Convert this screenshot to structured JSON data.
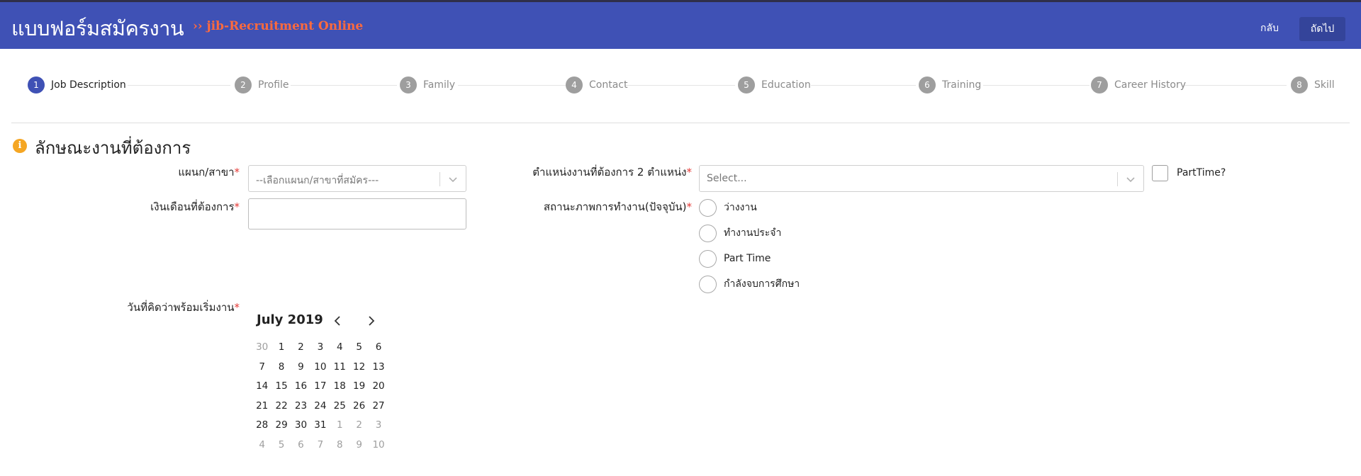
{
  "header": {
    "title": "แบบฟอร์มสมัครงาน",
    "subtitle": "›› jib-Recruitment Online",
    "back_label": "กลับ",
    "next_label": "ถัดไป",
    "bg_color": "#3f51b5",
    "accent_color": "#ff6a3d"
  },
  "steps": [
    {
      "num": "1",
      "label": "Job Description",
      "active": true
    },
    {
      "num": "2",
      "label": "Profile"
    },
    {
      "num": "3",
      "label": "Family"
    },
    {
      "num": "4",
      "label": "Contact"
    },
    {
      "num": "5",
      "label": "Education"
    },
    {
      "num": "6",
      "label": "Training"
    },
    {
      "num": "7",
      "label": "Career History"
    },
    {
      "num": "8",
      "label": "Skill"
    }
  ],
  "section": {
    "icon": "info-icon",
    "title": "ลักษณะงานที่ต้องการ"
  },
  "form": {
    "department_label": "แผนก/สาขา",
    "department_placeholder": "--เลือกแผนก/สาขาที่สมัคร---",
    "salary_label": "เงินเดือนที่ต้องการ",
    "salary_value": "",
    "position_label": "ตำแหน่งงานที่ต้องการ 2 ตำแหน่ง",
    "position_placeholder": "Select...",
    "parttime_label": "PartTime?",
    "status_label": "สถานะภาพการทำงาน(ปัจจุบัน)",
    "status_options": [
      "ว่างงาน",
      "ทำงานประจำ",
      "Part Time",
      "กำลังจบการศึกษา"
    ],
    "start_date_label": "วันที่คิดว่าพร้อมเริ่มงาน",
    "required_mark": "*"
  },
  "calendar": {
    "month_label": "July 2019",
    "weeks": [
      [
        "30",
        "1",
        "2",
        "3",
        "4",
        "5",
        "6"
      ],
      [
        "7",
        "8",
        "9",
        "10",
        "11",
        "12",
        "13"
      ],
      [
        "14",
        "15",
        "16",
        "17",
        "18",
        "19",
        "20"
      ],
      [
        "21",
        "22",
        "23",
        "24",
        "25",
        "26",
        "27"
      ],
      [
        "28",
        "29",
        "30",
        "31",
        "1",
        "2",
        "3"
      ],
      [
        "4",
        "5",
        "6",
        "7",
        "8",
        "9",
        "10"
      ]
    ],
    "muted": [
      [
        true,
        false,
        false,
        false,
        false,
        false,
        false
      ],
      [
        false,
        false,
        false,
        false,
        false,
        false,
        false
      ],
      [
        false,
        false,
        false,
        false,
        false,
        false,
        false
      ],
      [
        false,
        false,
        false,
        false,
        false,
        false,
        false
      ],
      [
        false,
        false,
        false,
        false,
        true,
        true,
        true
      ],
      [
        true,
        true,
        true,
        true,
        true,
        true,
        true
      ]
    ]
  }
}
